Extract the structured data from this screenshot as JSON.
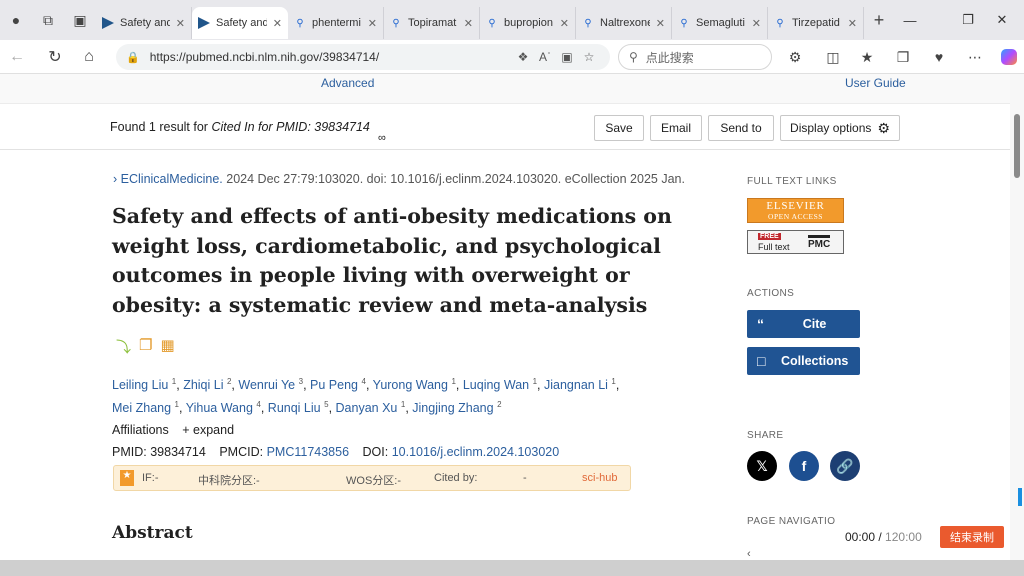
{
  "browser": {
    "tabs": [
      {
        "label": "Safety and",
        "favicon": "pubmed-icon",
        "active": false
      },
      {
        "label": "Safety and",
        "favicon": "pubmed-icon",
        "active": true
      },
      {
        "label": "phentermi",
        "favicon": "search-icon",
        "active": false
      },
      {
        "label": "Topiramat",
        "favicon": "search-icon",
        "active": false
      },
      {
        "label": "bupropion",
        "favicon": "search-icon",
        "active": false
      },
      {
        "label": "Naltrexone",
        "favicon": "search-icon",
        "active": false
      },
      {
        "label": "Semagluti",
        "favicon": "search-icon",
        "active": false
      },
      {
        "label": "Tirzepatid",
        "favicon": "search-icon",
        "active": false
      }
    ],
    "url": "https://pubmed.ncbi.nlm.nih.gov/39834714/",
    "search_placeholder": "点此搜索"
  },
  "page": {
    "top_links": {
      "advanced": "Advanced",
      "user_guide": "User Guide"
    },
    "found": {
      "prefix": "Found 1 result for ",
      "query": "Cited In for PMID: 39834714"
    },
    "buttons": {
      "save": "Save",
      "email": "Email",
      "send_to": "Send to",
      "display_options": "Display options"
    },
    "citation": {
      "journal": "EClinicalMedicine.",
      "details": "2024 Dec 27:79:103020. doi: 10.1016/j.eclinm.2024.103020. eCollection 2025 Jan."
    },
    "title": "Safety and effects of anti-obesity medications on weight loss, cardiometabolic, and psychological outcomes in people living with overweight or obesity: a systematic review and meta-analysis",
    "authors": [
      {
        "name": "Leiling Liu",
        "aff": "1"
      },
      {
        "name": "Zhiqi Li",
        "aff": "2"
      },
      {
        "name": "Wenrui Ye",
        "aff": "3"
      },
      {
        "name": "Pu Peng",
        "aff": "4"
      },
      {
        "name": "Yurong Wang",
        "aff": "1"
      },
      {
        "name": "Luqing Wan",
        "aff": "1"
      },
      {
        "name": "Jiangnan Li",
        "aff": "1"
      },
      {
        "name": "Mei Zhang",
        "aff": "1"
      },
      {
        "name": "Yihua Wang",
        "aff": "4"
      },
      {
        "name": "Runqi Liu",
        "aff": "5"
      },
      {
        "name": "Danyan Xu",
        "aff": "1"
      },
      {
        "name": "Jingjing Zhang",
        "aff": "2"
      }
    ],
    "affiliations": {
      "label": "Affiliations",
      "expand": "expand"
    },
    "ids": {
      "pmid_label": "PMID:",
      "pmid": "39834714",
      "pmcid_label": "PMCID:",
      "pmcid": "PMC11743856",
      "doi_label": "DOI:",
      "doi": "10.1016/j.eclinm.2024.103020"
    },
    "plugin": {
      "if": "IF:-",
      "zky": "中科院分区:-",
      "wos": "WOS分区:-",
      "cited": "Cited by:",
      "dash": "-",
      "scihub": "sci-hub"
    },
    "abstract_heading": "Abstract"
  },
  "sidebar": {
    "full_text_heading": "FULL TEXT LINKS",
    "elsevier": {
      "line1": "ELSEVIER",
      "line2": "OPEN ACCESS"
    },
    "pmc": {
      "free": "FREE",
      "full_text": "Full text",
      "logo": "PMC"
    },
    "actions_heading": "ACTIONS",
    "cite": "Cite",
    "collections": "Collections",
    "share_heading": "SHARE",
    "page_nav_heading": "PAGE NAVIGATIO"
  },
  "overlay": {
    "time": "00:00",
    "total": "120:00",
    "record_button": "结束录制"
  },
  "colors": {
    "pubmed_blue": "#205493",
    "link_blue": "#2c5f9e",
    "record_orange": "#ea5a2e"
  }
}
